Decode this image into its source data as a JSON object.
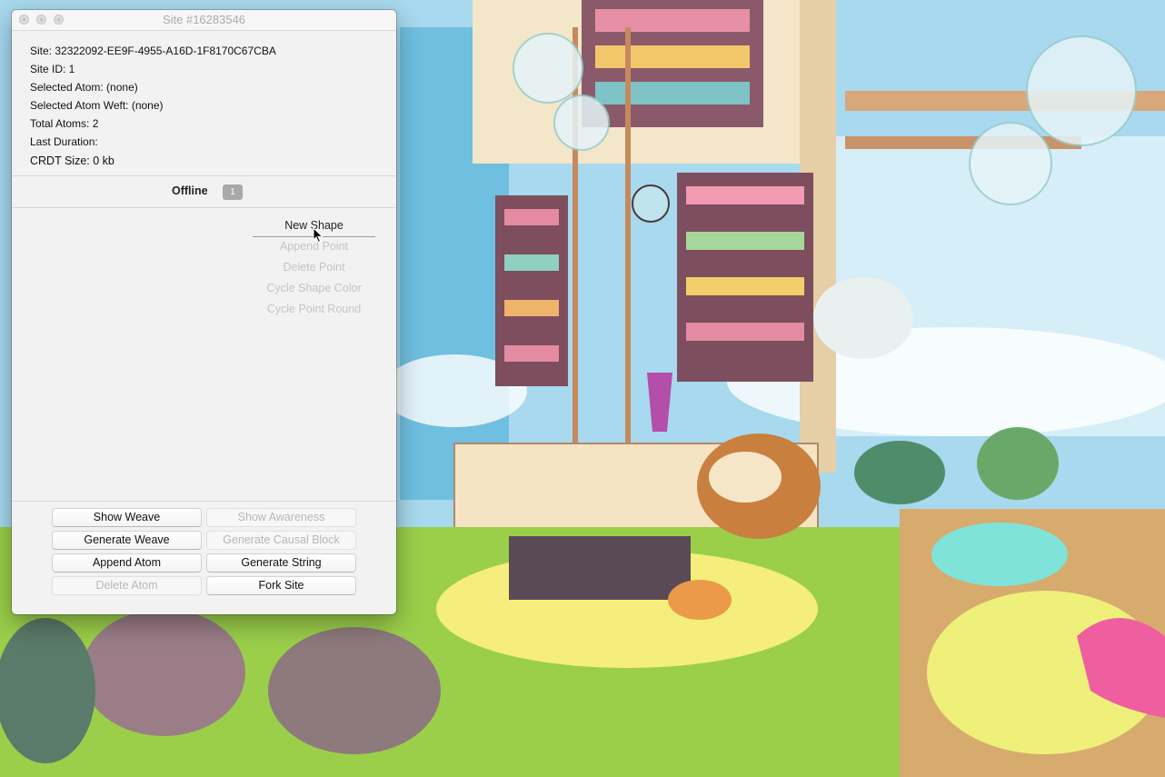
{
  "window": {
    "title": "Site #16283546"
  },
  "info": {
    "site": "Site: 32322092-EE9F-4955-A16D-1F8170C67CBA",
    "site_id": "Site ID: 1",
    "selected_atom": "Selected Atom: (none)",
    "selected_atom_weft": "Selected Atom Weft: (none)",
    "total_atoms": "Total Atoms: 2",
    "last_duration": "Last Duration:",
    "crdt_size": "CRDT Size: 0 kb"
  },
  "status": {
    "label": "Offline",
    "badge": "1"
  },
  "shape_menu": {
    "new_shape": "New Shape",
    "append_point": "Append Point",
    "delete_point": "Delete Point",
    "cycle_shape_color": "Cycle Shape Color",
    "cycle_point_round": "Cycle Point Round"
  },
  "buttons": {
    "show_weave": "Show Weave",
    "show_awareness": "Show Awareness",
    "generate_weave": "Generate Weave",
    "generate_causal_block": "Generate Causal Block",
    "append_atom": "Append Atom",
    "generate_string": "Generate String",
    "delete_atom": "Delete Atom",
    "fork_site": "Fork Site"
  },
  "colors": {
    "window_bg": "#f2f2f2",
    "badge_bg": "#a9a9a9",
    "disabled_text": "#c4c4c4"
  },
  "icons": {
    "close": "close-icon",
    "minimize": "minimize-icon",
    "zoom": "zoom-icon",
    "cursor": "arrow-cursor-icon"
  }
}
